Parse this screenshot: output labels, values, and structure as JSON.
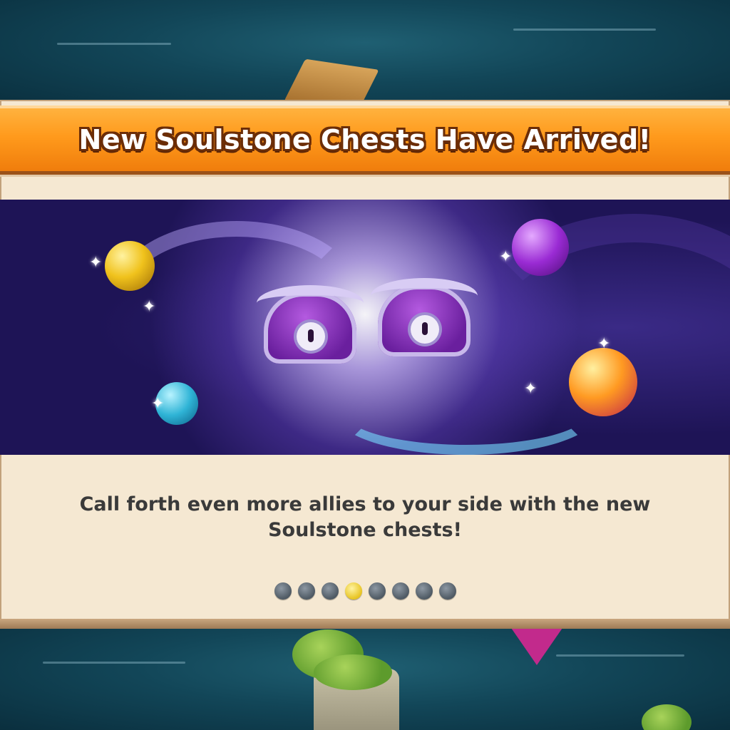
{
  "popup": {
    "title": "New Soulstone Chests Have Arrived!",
    "description": "Call forth even more allies to your side with the new Soulstone chests!"
  },
  "pagination": {
    "total_pages": 8,
    "current_page": 4
  },
  "colors": {
    "header_orange": "#ff9a1c",
    "panel_cream": "#f5e8d2",
    "text_dark": "#3a3a3a",
    "active_dot": "#e7c320",
    "inactive_dot": "#4e5963"
  },
  "icons": {
    "soulstone_chest": "purple-chest-icon",
    "gold_soulstone": "gold-soulstone-icon",
    "purple_soulstone": "purple-soulstone-icon",
    "blue_soulstone": "blue-soulstone-icon",
    "orange_soulstone": "orange-soulstone-icon"
  }
}
